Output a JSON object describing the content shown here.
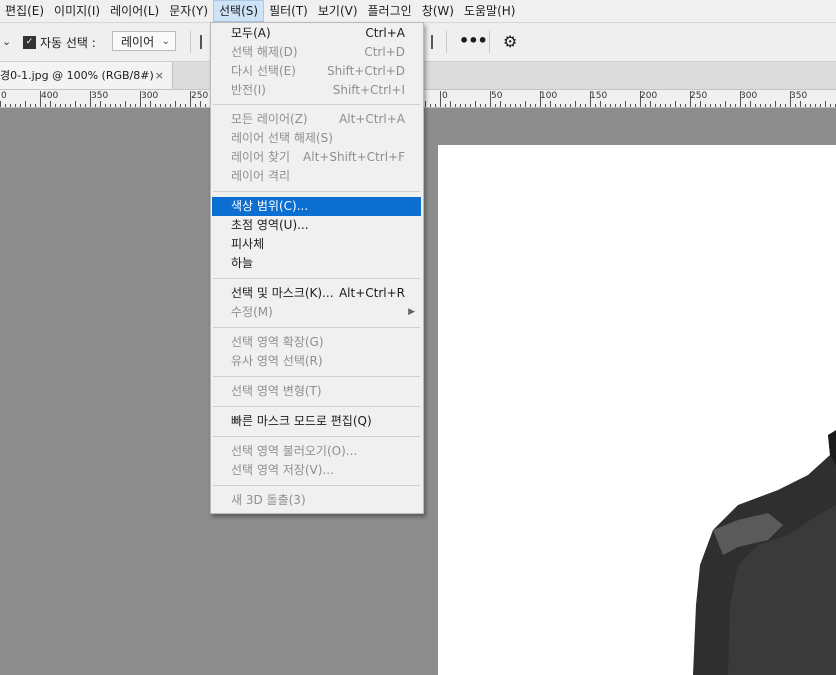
{
  "menubar": {
    "items": [
      "편집(E)",
      "이미지(I)",
      "레이어(L)",
      "문자(Y)",
      "선택(S)",
      "필터(T)",
      "보기(V)",
      "플러그인",
      "창(W)",
      "도움말(H)"
    ]
  },
  "options": {
    "auto_select_label": "자동 선택 :",
    "layer_select_value": "레이어",
    "more_icon": "•••",
    "gear_icon": "⚙"
  },
  "document_tab": {
    "title": "경0-1.jpg @ 100% (RGB/8#)",
    "close": "×"
  },
  "ruler": {
    "left_labels": [
      "0",
      "400",
      "350",
      "300",
      "250"
    ],
    "right_labels": [
      "0",
      "50",
      "100",
      "150",
      "200",
      "250",
      "300",
      "350"
    ]
  },
  "select_menu": {
    "all": {
      "label": "모두(A)",
      "shortcut": "Ctrl+A"
    },
    "deselect": {
      "label": "선택 해제(D)",
      "shortcut": "Ctrl+D"
    },
    "reselect": {
      "label": "다시 선택(E)",
      "shortcut": "Shift+Ctrl+D"
    },
    "inverse": {
      "label": "반전(I)",
      "shortcut": "Shift+Ctrl+I"
    },
    "all_layers": {
      "label": "모든 레이어(Z)",
      "shortcut": "Alt+Ctrl+A"
    },
    "deselect_layers": {
      "label": "레이어 선택 해제(S)"
    },
    "find_layers": {
      "label": "레이어 찾기",
      "shortcut": "Alt+Shift+Ctrl+F"
    },
    "isolate_layers": {
      "label": "레이어 격리"
    },
    "color_range": {
      "label": "색상 범위(C)..."
    },
    "focus_area": {
      "label": "초점 영역(U)..."
    },
    "subject": {
      "label": "피사체"
    },
    "sky": {
      "label": "하늘"
    },
    "select_and_mask": {
      "label": "선택 및 마스크(K)...",
      "shortcut": "Alt+Ctrl+R"
    },
    "modify": {
      "label": "수정(M)"
    },
    "grow": {
      "label": "선택 영역 확장(G)"
    },
    "similar": {
      "label": "유사 영역 선택(R)"
    },
    "transform": {
      "label": "선택 영역 변형(T)"
    },
    "quick_mask": {
      "label": "빠른 마스크 모드로 편집(Q)"
    },
    "load": {
      "label": "선택 영역 불러오기(O)..."
    },
    "save": {
      "label": "선택 영역 저장(V)..."
    },
    "new_3d": {
      "label": "새 3D 돌출(3)"
    }
  }
}
